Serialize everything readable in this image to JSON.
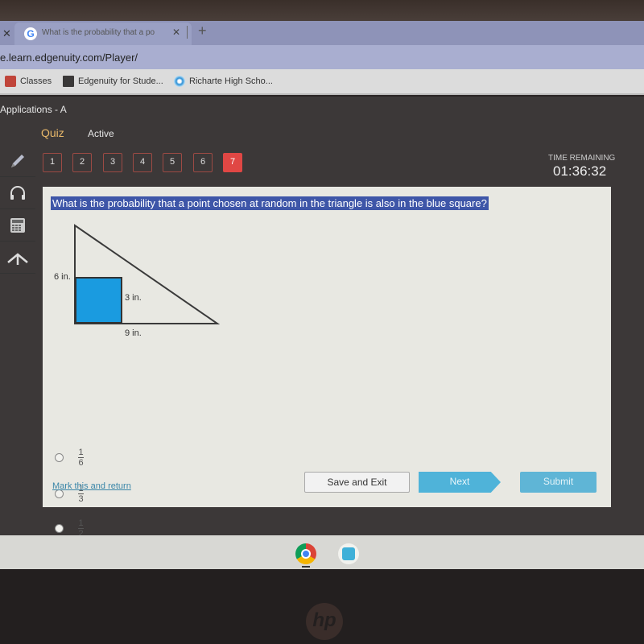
{
  "browser": {
    "tab_title": "What is the probability that a po",
    "url": "e.learn.edgenuity.com/Player/",
    "bookmarks": [
      {
        "label": "Classes",
        "icon": "classroom-icon"
      },
      {
        "label": "Edgenuity for Stude...",
        "icon": "edgenuity-icon"
      },
      {
        "label": "Richarte High Scho...",
        "icon": "school-icon"
      }
    ]
  },
  "app": {
    "title": "Applications - A",
    "mode": "Quiz",
    "status": "Active",
    "questions": [
      "1",
      "2",
      "3",
      "4",
      "5",
      "6",
      "7"
    ],
    "current_question": "7",
    "timer_label": "TIME REMAINING",
    "timer": "01:36:32"
  },
  "question": {
    "text": "What is the probability that a point chosen at random in the triangle is also in the blue square?",
    "figure": {
      "triangle_height_label": "6 in.",
      "square_side_label": "3 in.",
      "triangle_base_label": "9 in.",
      "square_color": "#1a9be0"
    },
    "choices": [
      {
        "numerator": "1",
        "denominator": "6"
      },
      {
        "numerator": "1",
        "denominator": "3"
      },
      {
        "numerator": "1",
        "denominator": "2"
      }
    ]
  },
  "footer": {
    "mark_link": "Mark this and return",
    "save_label": "Save and Exit",
    "next_label": "Next",
    "submit_label": "Submit"
  },
  "device": {
    "brand": "hp"
  }
}
